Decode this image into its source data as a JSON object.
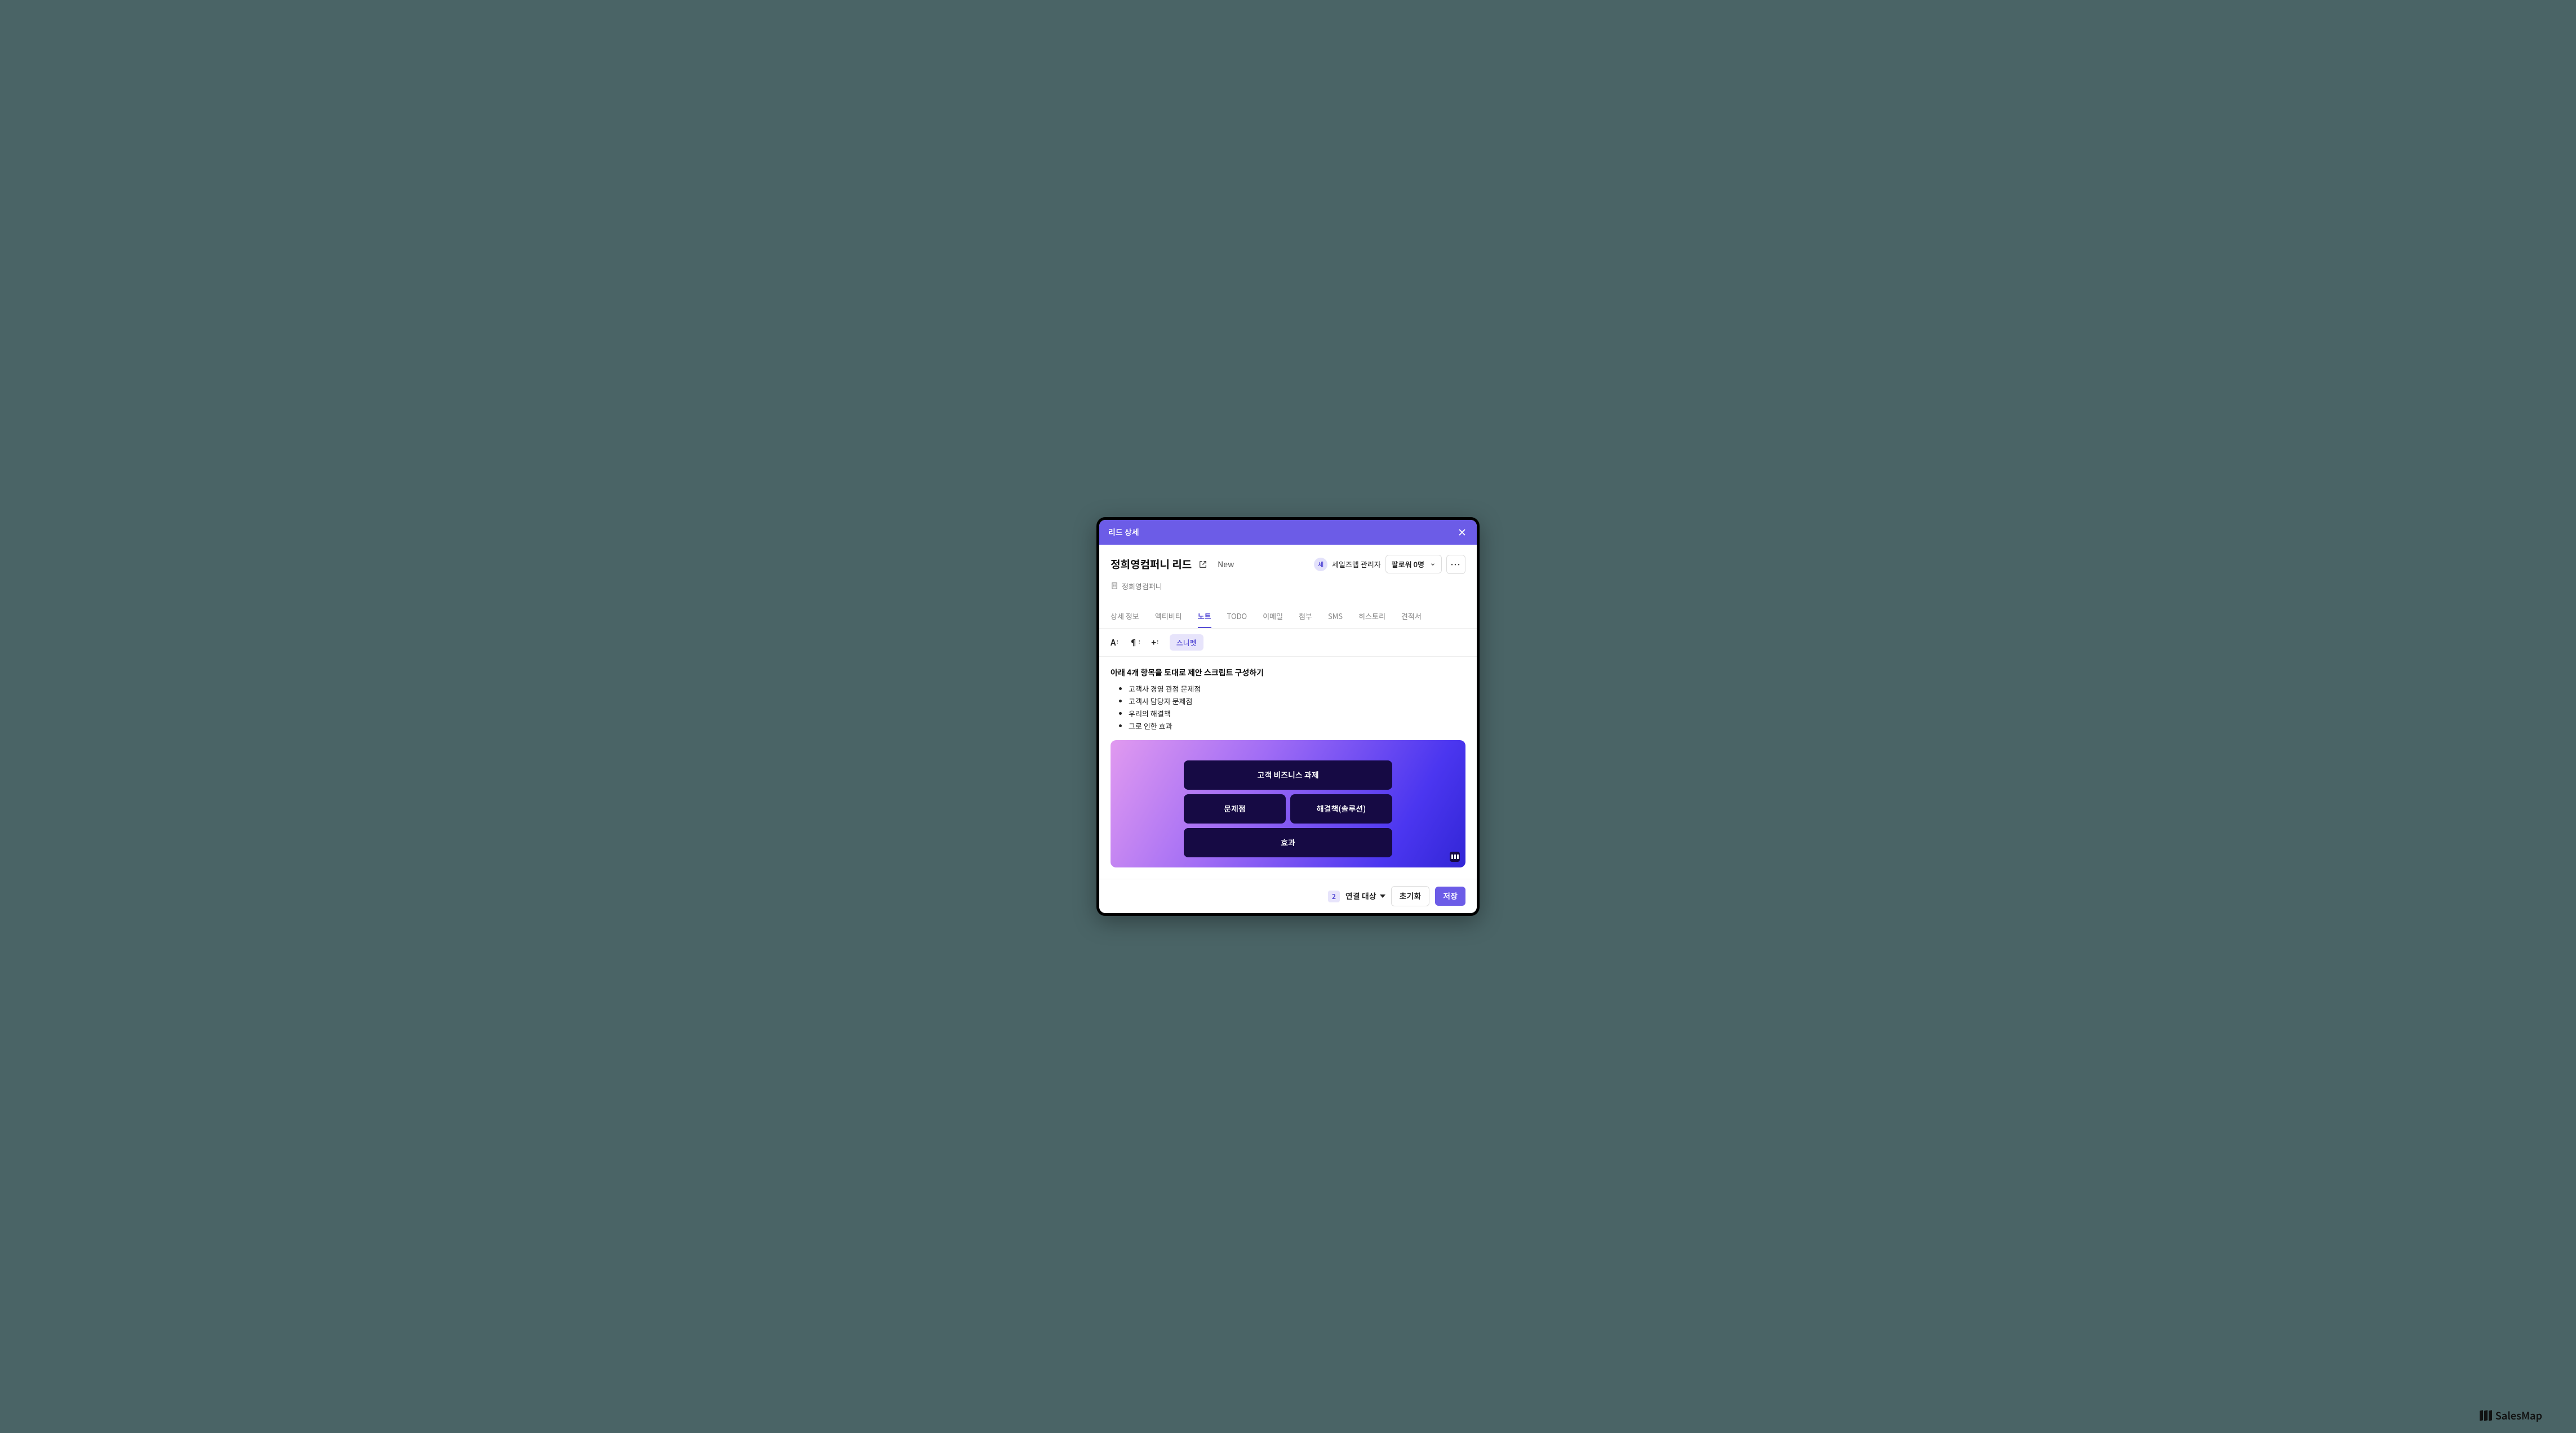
{
  "header": {
    "title": "리드 상세"
  },
  "lead": {
    "title": "정희영컴퍼니 리드",
    "status": "New",
    "company": "정희영컴퍼니"
  },
  "owner": {
    "avatar_char": "세",
    "name": "세일즈맵 관리자"
  },
  "followers": {
    "label": "팔로워 0명"
  },
  "tabs": [
    {
      "label": "상세 정보"
    },
    {
      "label": "액티비티"
    },
    {
      "label": "노트"
    },
    {
      "label": "TODO"
    },
    {
      "label": "이메일"
    },
    {
      "label": "첨부"
    },
    {
      "label": "SMS"
    },
    {
      "label": "히스토리"
    },
    {
      "label": "견적서"
    }
  ],
  "toolbar": {
    "snippet_label": "스니펫"
  },
  "note": {
    "heading": "아래 4개 항목을 토대로 제안 스크립트 구성하기",
    "bullets": {
      "b0": "고객사 경영 관점 문제점",
      "b1": "고객사 담당자 문제점",
      "b2": "우리의 해결책",
      "b3": "그로 인한 효과"
    }
  },
  "diagram": {
    "top": "고객 비즈니스 과제",
    "left": "문제점",
    "right": "해결책(솔루션)",
    "bottom": "효과"
  },
  "footer": {
    "count": "2",
    "link_label": "연결 대상",
    "reset": "초기화",
    "save": "저장"
  },
  "brand": "SalesMap"
}
